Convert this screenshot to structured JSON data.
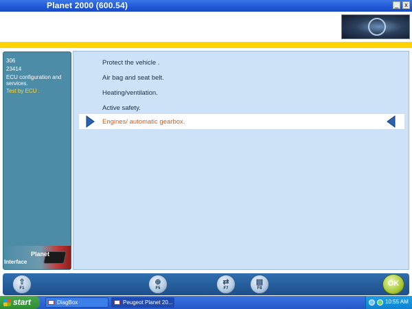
{
  "window": {
    "title": "Planet 2000 (600.54)",
    "buttons": {
      "minimize": "_",
      "close": "x"
    }
  },
  "header": {
    "logo_icon": "brand-logo-icon"
  },
  "vehicle_panel": {
    "model": "306",
    "code": "23414",
    "context": "ECU configuration and services.",
    "action": "Test by ECU .",
    "footer_planet": "Planet",
    "footer_interface": "Interface"
  },
  "menu": {
    "items": [
      "Protect the vehicle .",
      "Air bag and seat belt.",
      "Heating/ventilation.",
      "Active safety."
    ],
    "selected": "Engines/  automatic gearbox.",
    "selected_color": "#d45a1a"
  },
  "function_keys": [
    {
      "label": "F1",
      "icon": "help-up-arrow-icon"
    },
    {
      "label": "F5",
      "icon": "search-icon"
    },
    {
      "label": "F7",
      "icon": "exchange-icon"
    },
    {
      "label": "F8",
      "icon": "print-icon"
    },
    {
      "label": "OK",
      "icon": "ok-icon"
    }
  ],
  "taskbar": {
    "start_label": "start",
    "tasks": [
      {
        "label": "DiagBox"
      },
      {
        "label": "Peugeot Planet 20..."
      }
    ],
    "clock": "10:55 AM"
  },
  "colors": {
    "accent_yellow": "#ffd400",
    "panel_teal": "#4c8ca6",
    "main_bg": "#cde2f7",
    "selected_text": "#d45a1a"
  }
}
